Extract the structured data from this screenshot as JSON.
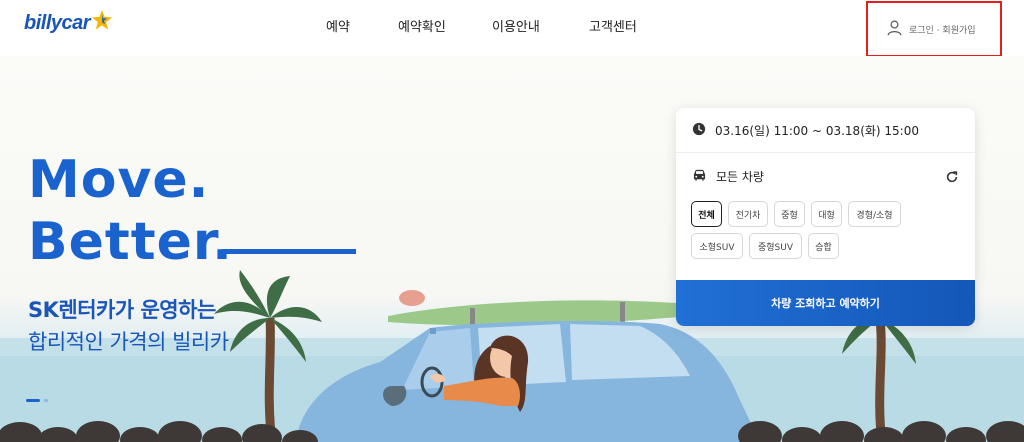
{
  "header": {
    "logo_text": "billycar",
    "nav": [
      "예약",
      "예약확인",
      "이용안내",
      "고객센터"
    ],
    "user_text": "로그인 · 회원가입"
  },
  "hero": {
    "headline_1": "Move.",
    "headline_2": "Better.",
    "subtitle_1": "SK렌터카가 운영하는",
    "subtitle_2": "합리적인 가격의 빌리카",
    "slide_count": 2,
    "active_slide": 1
  },
  "booking": {
    "date_range": "03.16(일) 11:00 ~ 03.18(화) 15:00",
    "vehicle_label": "모든 차량",
    "categories": [
      "전체",
      "전기차",
      "중형",
      "대형",
      "경형/소형",
      "소형SUV",
      "중형SUV",
      "승합"
    ],
    "selected_category": "전체",
    "submit_label": "차량 조회하고 예약하기"
  },
  "colors": {
    "brand_blue": "#1a63cf",
    "highlight_red": "#e0201b",
    "logo_star": "#f5b800"
  }
}
